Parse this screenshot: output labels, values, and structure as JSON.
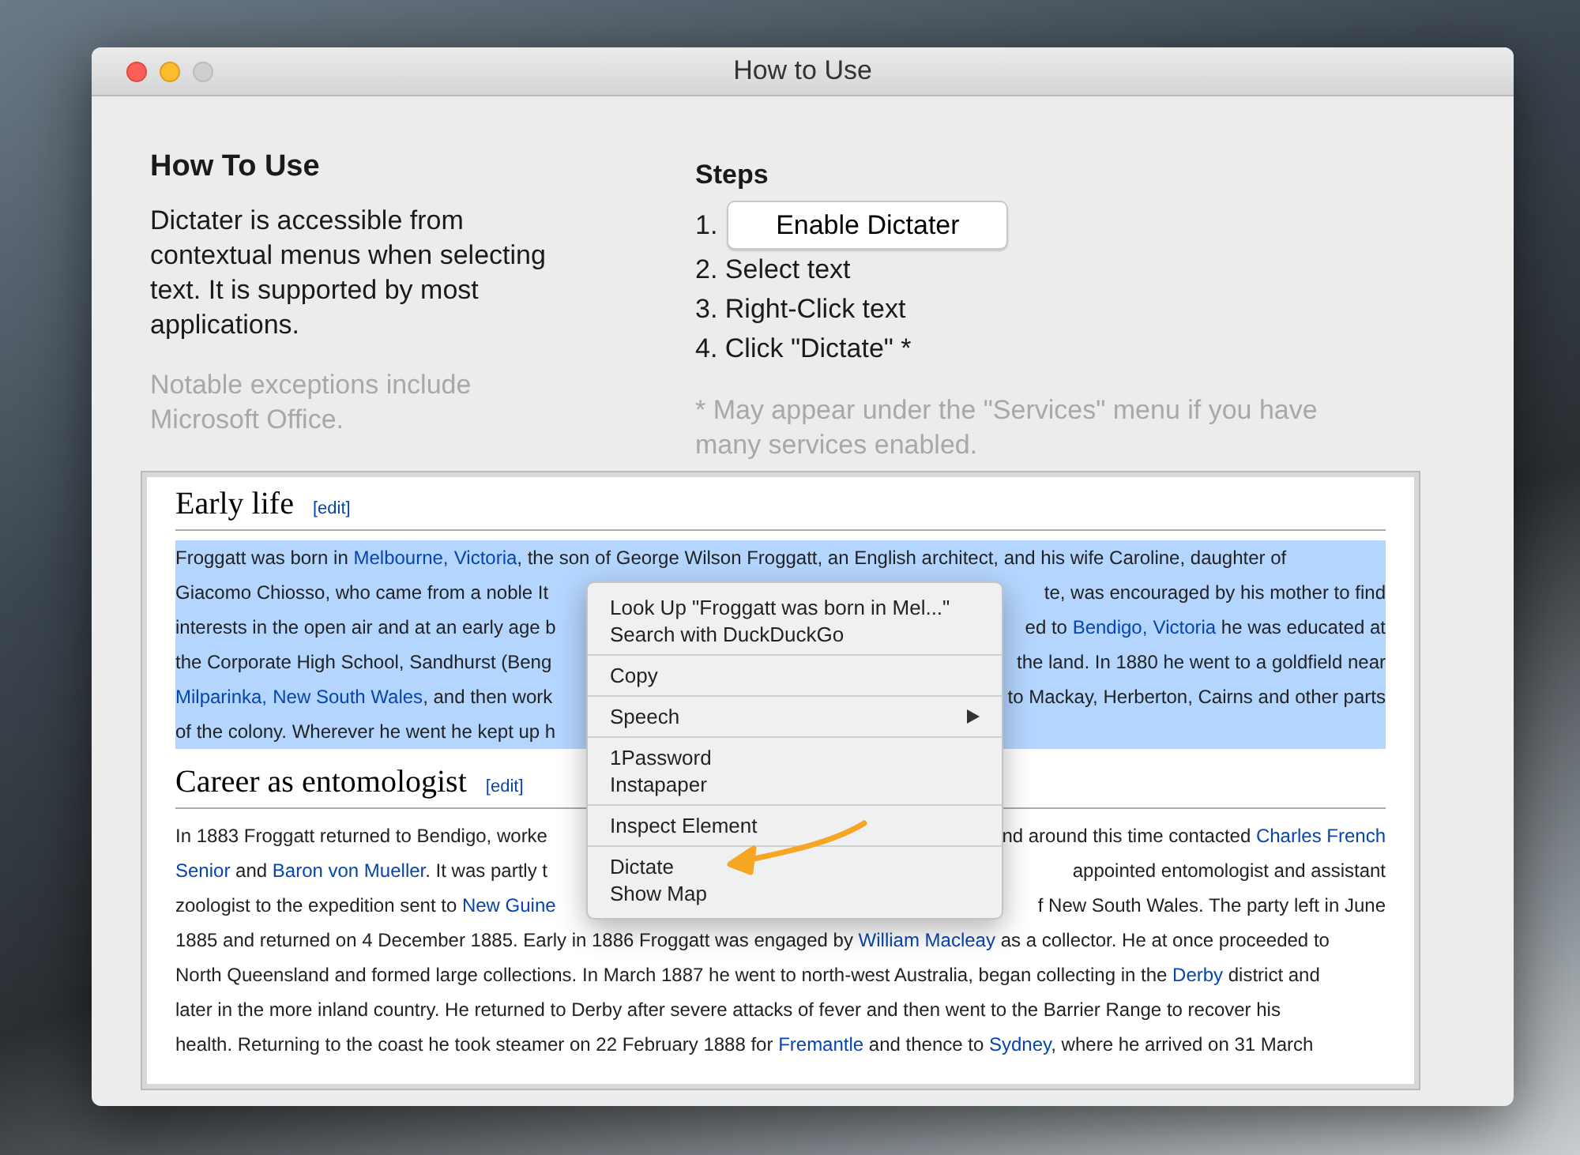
{
  "window": {
    "title": "How to Use",
    "controls": [
      {
        "kind": "close",
        "disabled": false
      },
      {
        "kind": "minimize",
        "disabled": false
      },
      {
        "kind": "zoom",
        "disabled": true
      }
    ]
  },
  "intro": {
    "heading": "How To Use",
    "body": "Dictater is accessible from contextual menus when selecting text. It is supported by most applications.",
    "note": "Notable exceptions include Microsoft Office."
  },
  "steps": {
    "heading": "Steps",
    "items": [
      {
        "kind": "button",
        "number": "1.",
        "label": "Enable Dictater"
      },
      {
        "kind": "text",
        "label": "2. Select text"
      },
      {
        "kind": "text",
        "label": "3. Right-Click text"
      },
      {
        "kind": "text",
        "label": "4. Click \"Dictate\" *"
      }
    ],
    "note": "* May appear under the \"Services\" menu if you have many services enabled."
  },
  "article": {
    "sections": [
      {
        "heading": "Early life",
        "edit": "[edit]",
        "selected": true,
        "lines": [
          {
            "left": [
              {
                "text": "Froggatt was born in "
              },
              {
                "text": "Melbourne,",
                "link": true
              },
              {
                "text": "Victoria",
                "link": true
              },
              {
                "text": ", the son of George Wilson Froggatt, an English architect, and his wife Caroline, daughter of"
              }
            ]
          },
          {
            "left": [
              {
                "text": "Giacomo Chiosso, who came from a noble It"
              }
            ],
            "right": [
              {
                "text": "te, was encouraged by his mother to find"
              }
            ]
          },
          {
            "left": [
              {
                "text": "interests in the open air and at an early age b"
              }
            ],
            "right": [
              {
                "text": "ed to "
              },
              {
                "text": "Bendigo,",
                "link": true
              },
              {
                "text": "Victoria",
                "link": true
              },
              {
                "text": " he was educated at"
              }
            ]
          },
          {
            "left": [
              {
                "text": "the Corporate High School, Sandhurst (Beng"
              }
            ],
            "right": [
              {
                "text": "the land. In 1880 he went to a goldfield near"
              }
            ]
          },
          {
            "left": [
              {
                "text": "Milparinka,",
                "link": true
              },
              {
                "text": "New South Wales",
                "link": true
              },
              {
                "text": ", and then work"
              }
            ],
            "right": [
              {
                "text": "to Mackay, Herberton, Cairns and other parts"
              }
            ]
          },
          {
            "left": [
              {
                "text": "of the colony. Wherever he went he kept up h"
              }
            ]
          }
        ]
      },
      {
        "heading": "Career as entomologist",
        "edit": "[edit]",
        "selected": false,
        "lines": [
          {
            "left": [
              {
                "text": "In 1883 Froggatt returned to Bendigo, worke"
              }
            ],
            "right": [
              {
                "text": "nd around this time contacted "
              },
              {
                "text": "Charles French",
                "link": true
              }
            ]
          },
          {
            "left": [
              {
                "text": "Senior",
                "link": true
              },
              {
                "text": " and "
              },
              {
                "text": "Baron von Mueller",
                "link": true
              },
              {
                "text": ". It was partly t"
              }
            ],
            "right": [
              {
                "text": "appointed entomologist and assistant"
              }
            ]
          },
          {
            "left": [
              {
                "text": "zoologist to the expedition sent to "
              },
              {
                "text": "New Guine",
                "link": true
              }
            ],
            "right": [
              {
                "text": "f New South Wales. The party left in June"
              }
            ]
          },
          {
            "left": [
              {
                "text": "1885 and returned on 4 December 1885. Early in 1886 Froggatt was engaged by "
              },
              {
                "text": "William Macleay",
                "link": true
              },
              {
                "text": " as a collector. He at once proceeded to"
              }
            ]
          },
          {
            "left": [
              {
                "text": "North Queensland and formed large collections. In March 1887 he went to north-west Australia, began collecting in the "
              },
              {
                "text": "Derby",
                "link": true
              },
              {
                "text": " district and"
              }
            ]
          },
          {
            "left": [
              {
                "text": "later in the more inland country. He returned to Derby after severe attacks of fever and then went to the Barrier Range to recover his"
              }
            ]
          },
          {
            "left": [
              {
                "text": "health. Returning to the coast he took steamer on 22 February 1888 for "
              },
              {
                "text": "Fremantle",
                "link": true
              },
              {
                "text": " and thence to "
              },
              {
                "text": "Sydney",
                "link": true
              },
              {
                "text": ", where he arrived on 31 March"
              }
            ]
          }
        ]
      }
    ]
  },
  "context_menu": {
    "sections": [
      [
        {
          "kind": "item",
          "label": "Look Up \"Froggatt was born in Mel...\""
        },
        {
          "kind": "item",
          "label": "Search with DuckDuckGo"
        }
      ],
      [
        {
          "kind": "item",
          "label": "Copy"
        }
      ],
      [
        {
          "kind": "submenu",
          "label": "Speech"
        }
      ],
      [
        {
          "kind": "item",
          "label": "1Password"
        },
        {
          "kind": "item",
          "label": "Instapaper"
        }
      ],
      [
        {
          "kind": "item",
          "label": "Inspect Element"
        }
      ],
      [
        {
          "kind": "item",
          "label": "Dictate"
        },
        {
          "kind": "item",
          "label": "Show Map"
        }
      ]
    ]
  }
}
